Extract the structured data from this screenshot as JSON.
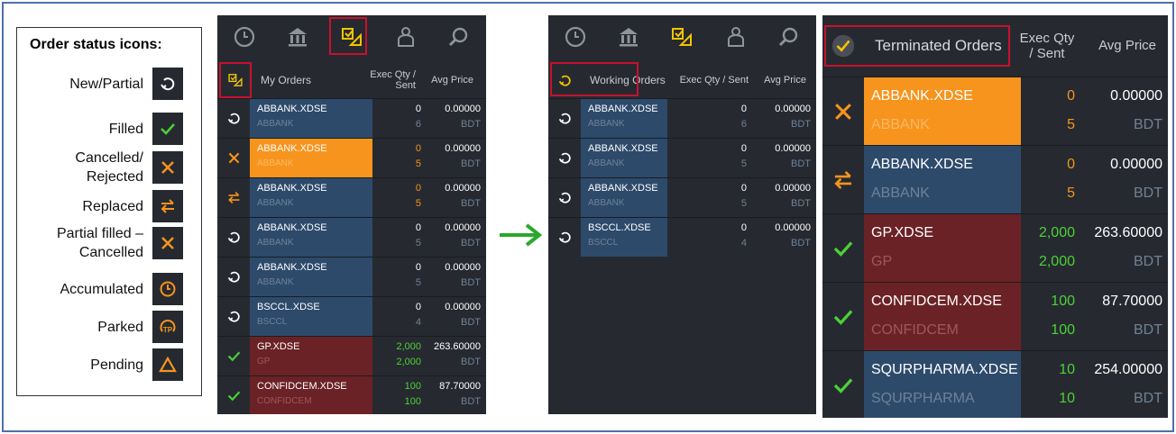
{
  "legend": {
    "title": "Order status icons:",
    "items": [
      {
        "label": "New/Partial",
        "icon": "refresh-icon"
      },
      {
        "label": "Filled",
        "icon": "check-icon"
      },
      {
        "label": "Cancelled/ Rejected",
        "icon": "x-icon"
      },
      {
        "label": "Replaced",
        "icon": "swap-icon"
      },
      {
        "label": "Partial filled – Cancelled",
        "icon": "x-icon"
      },
      {
        "label": "Accumulated",
        "icon": "clock-icon"
      },
      {
        "label": "Parked",
        "icon": "parked-tp-icon"
      },
      {
        "label": "Pending",
        "icon": "triangle-icon"
      }
    ]
  },
  "colors": {
    "panel_bg": "#262a30",
    "blue_row": "#2d4a6b",
    "orange_row": "#f7941d",
    "red_row": "#6b2226",
    "accent": "#f5c400",
    "green": "#4cd137",
    "highlight_box": "#c8102e"
  },
  "my_orders": {
    "title": "My Orders",
    "col_qty": "Exec Qty / Sent",
    "col_price": "Avg Price",
    "rows": [
      {
        "status": "refresh",
        "symbol": "ABBANK.XDSE",
        "sub": "ABBANK",
        "exec": "0",
        "sent": "6",
        "price": "0.00000",
        "ccy": "BDT",
        "color": "blue"
      },
      {
        "status": "cancelled",
        "symbol": "ABBANK.XDSE",
        "sub": "ABBANK",
        "exec": "0",
        "sent": "5",
        "price": "0.00000",
        "ccy": "BDT",
        "color": "orange"
      },
      {
        "status": "replaced",
        "symbol": "ABBANK.XDSE",
        "sub": "ABBANK",
        "exec": "0",
        "sent": "5",
        "price": "0.00000",
        "ccy": "BDT",
        "color": "blue"
      },
      {
        "status": "refresh",
        "symbol": "ABBANK.XDSE",
        "sub": "ABBANK",
        "exec": "0",
        "sent": "5",
        "price": "0.00000",
        "ccy": "BDT",
        "color": "blue"
      },
      {
        "status": "refresh",
        "symbol": "ABBANK.XDSE",
        "sub": "ABBANK",
        "exec": "0",
        "sent": "5",
        "price": "0.00000",
        "ccy": "BDT",
        "color": "blue"
      },
      {
        "status": "refresh",
        "symbol": "BSCCL.XDSE",
        "sub": "BSCCL",
        "exec": "0",
        "sent": "4",
        "price": "0.00000",
        "ccy": "BDT",
        "color": "blue"
      },
      {
        "status": "filled",
        "symbol": "GP.XDSE",
        "sub": "GP",
        "exec": "2,000",
        "sent": "2,000",
        "price": "263.60000",
        "ccy": "BDT",
        "color": "red"
      },
      {
        "status": "filled",
        "symbol": "CONFIDCEM.XDSE",
        "sub": "CONFIDCEM",
        "exec": "100",
        "sent": "100",
        "price": "87.70000",
        "ccy": "BDT",
        "color": "red"
      }
    ]
  },
  "working_orders": {
    "title": "Working Orders",
    "col_qty": "Exec Qty / Sent",
    "col_price": "Avg Price",
    "rows": [
      {
        "status": "refresh",
        "symbol": "ABBANK.XDSE",
        "sub": "ABBANK",
        "exec": "0",
        "sent": "6",
        "price": "0.00000",
        "ccy": "BDT",
        "color": "blue"
      },
      {
        "status": "refresh",
        "symbol": "ABBANK.XDSE",
        "sub": "ABBANK",
        "exec": "0",
        "sent": "5",
        "price": "0.00000",
        "ccy": "BDT",
        "color": "blue"
      },
      {
        "status": "refresh",
        "symbol": "ABBANK.XDSE",
        "sub": "ABBANK",
        "exec": "0",
        "sent": "5",
        "price": "0.00000",
        "ccy": "BDT",
        "color": "blue"
      },
      {
        "status": "refresh",
        "symbol": "BSCCL.XDSE",
        "sub": "BSCCL",
        "exec": "0",
        "sent": "4",
        "price": "0.00000",
        "ccy": "BDT",
        "color": "blue"
      }
    ]
  },
  "terminated_orders": {
    "title": "Terminated Orders",
    "col_qty": "Exec Qty / Sent",
    "col_price": "Avg Price",
    "rows": [
      {
        "status": "cancelled",
        "symbol": "ABBANK.XDSE",
        "sub": "ABBANK",
        "exec": "0",
        "sent": "5",
        "price": "0.00000",
        "ccy": "BDT",
        "color": "orange"
      },
      {
        "status": "replaced",
        "symbol": "ABBANK.XDSE",
        "sub": "ABBANK",
        "exec": "0",
        "sent": "5",
        "price": "0.00000",
        "ccy": "BDT",
        "color": "blue"
      },
      {
        "status": "filled",
        "symbol": "GP.XDSE",
        "sub": "GP",
        "exec": "2,000",
        "sent": "2,000",
        "price": "263.60000",
        "ccy": "BDT",
        "color": "red"
      },
      {
        "status": "filled",
        "symbol": "CONFIDCEM.XDSE",
        "sub": "CONFIDCEM",
        "exec": "100",
        "sent": "100",
        "price": "87.70000",
        "ccy": "BDT",
        "color": "red"
      },
      {
        "status": "filled",
        "symbol": "SQURPHARMA.XDSE",
        "sub": "SQURPHARMA",
        "exec": "10",
        "sent": "10",
        "price": "254.00000",
        "ccy": "BDT",
        "color": "blue"
      }
    ]
  },
  "toolbar_icons": [
    "clock-icon",
    "bank-icon",
    "orders-icon",
    "person-icon",
    "search-icon"
  ]
}
